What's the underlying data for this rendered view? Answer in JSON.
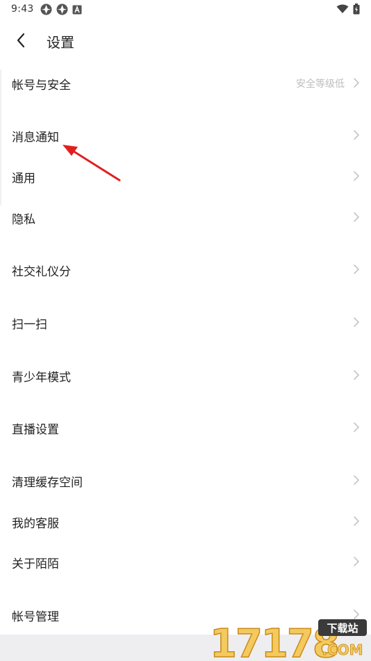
{
  "status_bar": {
    "time": "9:43",
    "left_icons": [
      "notification-app-icon",
      "notification-app-icon",
      "notification-a-icon"
    ],
    "right_icons": [
      "wifi-icon",
      "battery-icon"
    ]
  },
  "nav": {
    "title": "设置",
    "back_icon": "chevron-left-icon"
  },
  "settings": {
    "items": [
      {
        "label": "帐号与安全",
        "value": "安全等级低"
      },
      {
        "label": "消息通知",
        "value": ""
      },
      {
        "label": "通用",
        "value": ""
      },
      {
        "label": "隐私",
        "value": ""
      },
      {
        "label": "社交礼仪分",
        "value": ""
      },
      {
        "label": "扫一扫",
        "value": ""
      },
      {
        "label": "青少年模式",
        "value": ""
      },
      {
        "label": "直播设置",
        "value": ""
      },
      {
        "label": "清理缓存空间",
        "value": ""
      },
      {
        "label": "我的客服",
        "value": ""
      },
      {
        "label": "关于陌陌",
        "value": ""
      },
      {
        "label": "帐号管理",
        "value": ""
      }
    ]
  },
  "annotation": {
    "icon": "red-arrow-icon",
    "color": "#e02020"
  },
  "watermark": {
    "text": "17178",
    "badge": "下载站",
    "suffix": ".COM"
  },
  "colors": {
    "text": "#222222",
    "secondary": "#bdbdbd",
    "chevron": "#c4c4c4",
    "bottom_strip": "#eeeef0"
  }
}
